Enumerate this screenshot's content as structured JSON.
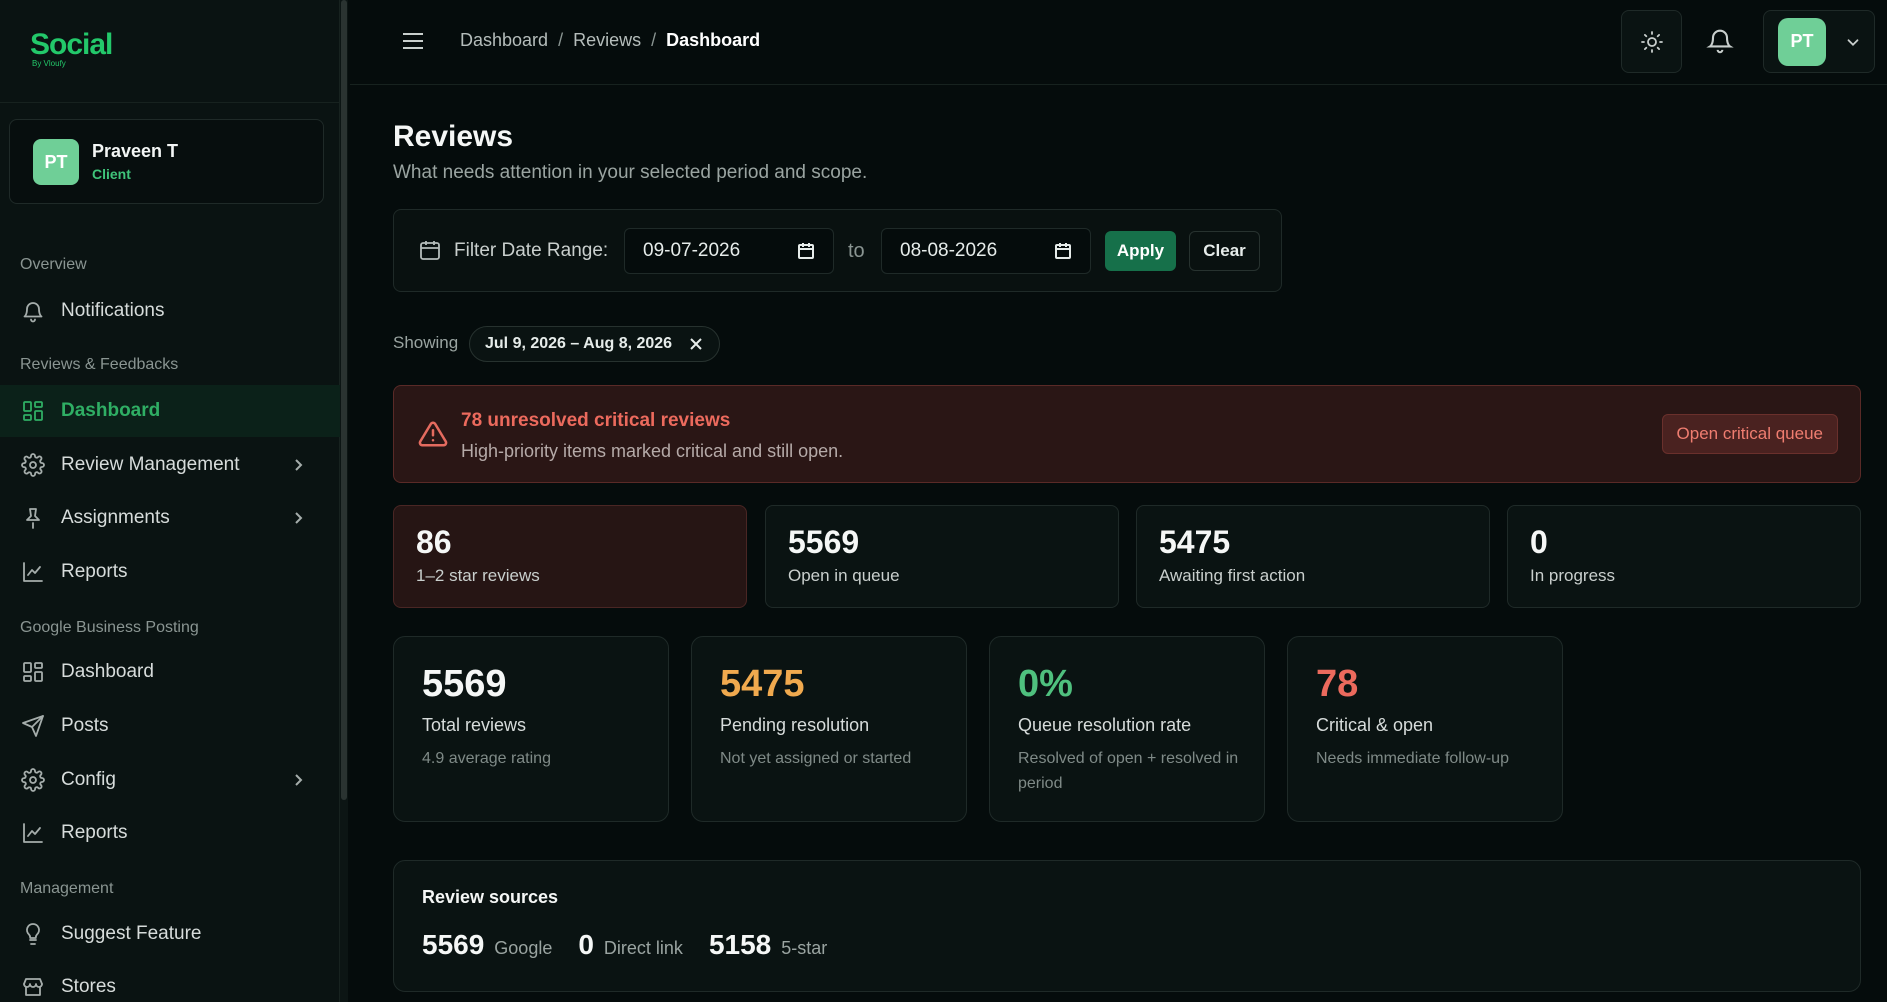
{
  "brand": {
    "name": "Social",
    "tagline": "By Vloufy"
  },
  "user": {
    "initials": "PT",
    "name": "Praveen T",
    "role": "Client"
  },
  "sidebar": {
    "sections": [
      {
        "label": "Overview"
      },
      {
        "label": "Reviews & Feedbacks"
      },
      {
        "label": "Google Business Posting"
      },
      {
        "label": "Management"
      }
    ],
    "items": [
      {
        "label": "Notifications",
        "icon": "bell-icon"
      },
      {
        "label": "Dashboard",
        "icon": "grid-icon",
        "active": true
      },
      {
        "label": "Review Management",
        "icon": "gear-icon",
        "expandable": true
      },
      {
        "label": "Assignments",
        "icon": "pin-icon",
        "expandable": true
      },
      {
        "label": "Reports",
        "icon": "line-chart-icon"
      },
      {
        "label": "Dashboard",
        "icon": "grid-icon"
      },
      {
        "label": "Posts",
        "icon": "send-icon"
      },
      {
        "label": "Config",
        "icon": "gear-icon",
        "expandable": true
      },
      {
        "label": "Reports",
        "icon": "line-chart-icon"
      },
      {
        "label": "Suggest Feature",
        "icon": "lightbulb-icon"
      },
      {
        "label": "Stores",
        "icon": "store-icon"
      }
    ]
  },
  "header": {
    "breadcrumb": [
      "Dashboard",
      "Reviews",
      "Dashboard"
    ],
    "avatar_initials": "PT"
  },
  "page": {
    "title": "Reviews",
    "subtitle": "What needs attention in your selected period and scope."
  },
  "filter": {
    "label": "Filter Date Range:",
    "from": "09-07-2026",
    "to_word": "to",
    "to": "08-08-2026",
    "apply_label": "Apply",
    "clear_label": "Clear"
  },
  "showing": {
    "label": "Showing",
    "range": "Jul 9, 2026 – Aug 8, 2026"
  },
  "alert": {
    "title": "78 unresolved critical reviews",
    "subtitle": "High-priority items marked critical and still open.",
    "button": "Open critical queue"
  },
  "stats": [
    {
      "value": "86",
      "label": "1–2 star reviews"
    },
    {
      "value": "5569",
      "label": "Open in queue"
    },
    {
      "value": "5475",
      "label": "Awaiting first action"
    },
    {
      "value": "0",
      "label": "In progress"
    }
  ],
  "kpis": [
    {
      "value": "5569",
      "label": "Total reviews",
      "sub": "4.9 average rating",
      "color": "#f5f7f6"
    },
    {
      "value": "5475",
      "label": "Pending resolution",
      "sub": "Not yet assigned or started",
      "color": "#f0a94e"
    },
    {
      "value": "0%",
      "label": "Queue resolution rate",
      "sub": "Resolved of open + resolved in period",
      "color": "#4fc07e"
    },
    {
      "value": "78",
      "label": "Critical & open",
      "sub": "Needs immediate follow-up",
      "color": "#ec6a5d"
    }
  ],
  "sources": {
    "title": "Review sources",
    "items": [
      {
        "value": "5569",
        "label": "Google"
      },
      {
        "value": "0",
        "label": "Direct link"
      },
      {
        "value": "5158",
        "label": "5-star"
      }
    ]
  }
}
